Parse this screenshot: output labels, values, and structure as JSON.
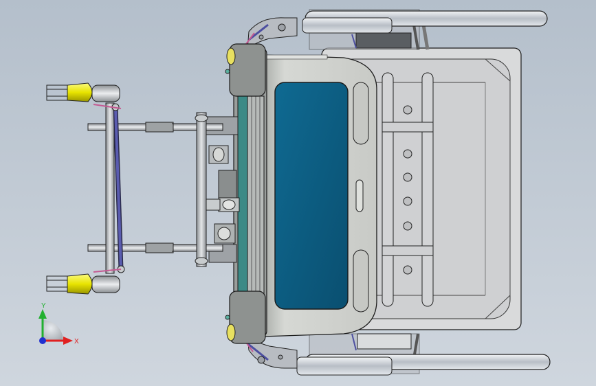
{
  "viewport": {
    "background_top": "#b4bfcb",
    "background_bottom": "#cfd6de"
  },
  "model": {
    "window_color": "#0d5a7e",
    "frame_color": "#d8dada",
    "edge_color": "#1a1a1a",
    "accent_blue": "#4d4fa0",
    "accent_pink": "#c45a92",
    "caster_yellow": "#e8e400"
  },
  "triad": {
    "x_label": "X",
    "y_label": "Y",
    "x_color": "#e02020",
    "y_color": "#22b030",
    "z_color": "#2030d0"
  }
}
